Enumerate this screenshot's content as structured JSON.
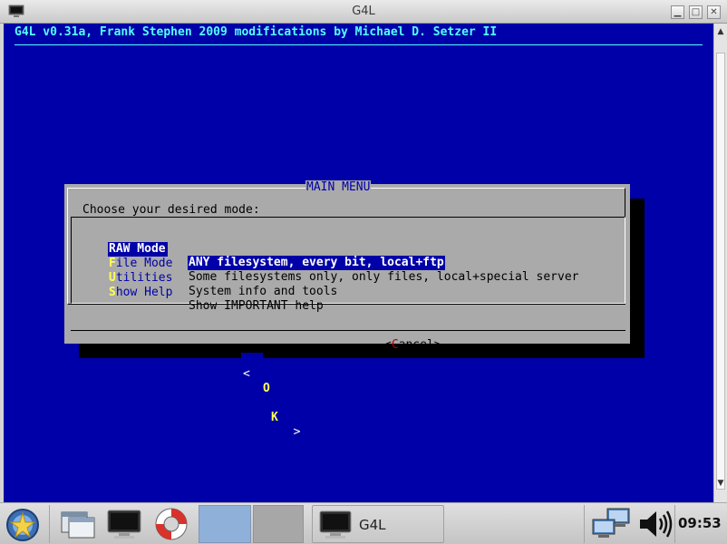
{
  "window": {
    "title": "G4L"
  },
  "terminal": {
    "backtitle": "G4L v0.31a, Frank Stephen 2009 modifications by Michael D. Setzer II"
  },
  "dialog": {
    "title": "MAIN MENU",
    "prompt": "Choose your desired mode:",
    "items": [
      {
        "hot": "R",
        "rest": "AW Mode",
        "tag": "RAW Mode",
        "description": "ANY filesystem, every bit, local+ftp",
        "selected": true
      },
      {
        "hot": "F",
        "rest": "ile Mode",
        "tag": "File Mode",
        "description": "Some filesystems only, only files, local+special server",
        "selected": false
      },
      {
        "hot": "U",
        "rest": "tilities",
        "tag": "Utilities",
        "description": "System info and tools",
        "selected": false
      },
      {
        "hot": "S",
        "rest": "how Help",
        "tag": "Show Help",
        "description": "Show IMPORTANT help",
        "selected": false
      }
    ],
    "ok": {
      "left": "<  ",
      "hot": "O",
      "rest": "K",
      "right": "  >"
    },
    "cancel": {
      "open": "<",
      "hot": "C",
      "rest": "ancel",
      "close": ">"
    }
  },
  "taskbar": {
    "task_label": "G4L",
    "clock": "09:53"
  },
  "colors": {
    "terminal_bg": "#0000a8",
    "dialog_bg": "#aaaaaa",
    "backtitle": "#55ffff",
    "hotkey": "#ffff55"
  }
}
